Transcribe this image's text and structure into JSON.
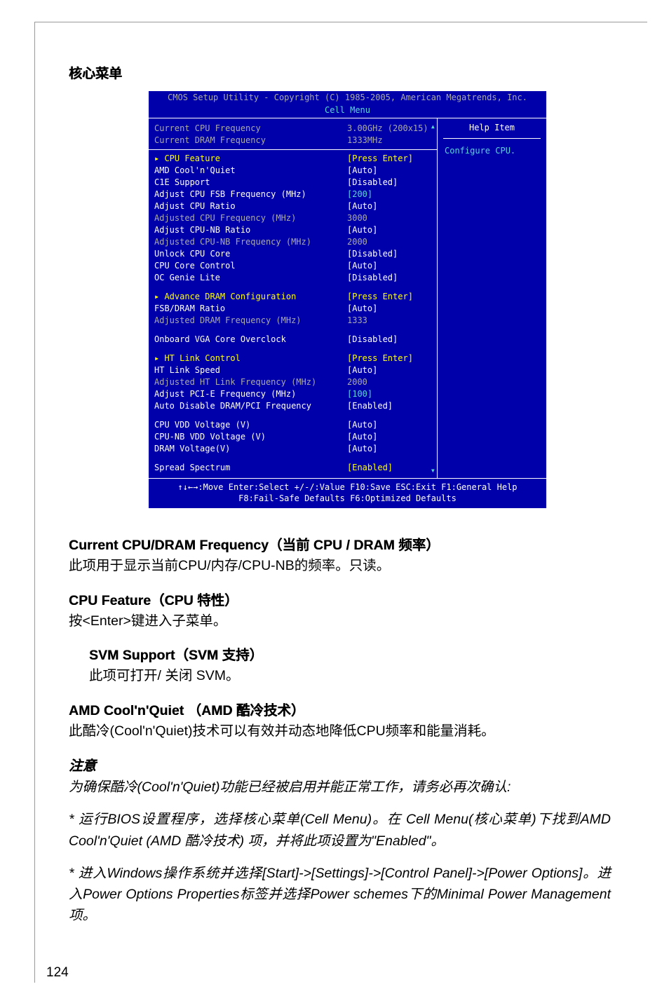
{
  "page": {
    "number": "124",
    "section_heading": "核心菜单"
  },
  "bios": {
    "titlebar": "CMOS Setup Utility - Copyright (C) 1985-2005, American Megatrends, Inc.",
    "subtitle": "Cell Menu",
    "help_title": "Help Item",
    "help_body": "Configure CPU.",
    "rows": [
      {
        "label": "Current CPU Frequency",
        "value": "3.00GHz (200x15)",
        "lcls": "bios-gray",
        "vcls": "bios-gray"
      },
      {
        "label": "Current DRAM Frequency",
        "value": "1333MHz",
        "lcls": "bios-gray",
        "vcls": "bios-gray"
      },
      {
        "type": "hr"
      },
      {
        "label": "▸ CPU Feature",
        "value": "[Press Enter]",
        "lcls": "bios-yellow",
        "vcls": "bios-yellow"
      },
      {
        "label": "AMD Cool'n'Quiet",
        "value": "[Auto]",
        "lcls": "bios-white",
        "vcls": "bios-white"
      },
      {
        "label": "C1E Support",
        "value": "[Disabled]",
        "lcls": "bios-white",
        "vcls": "bios-white"
      },
      {
        "label": "Adjust CPU FSB Frequency (MHz)",
        "value": "[200]",
        "lcls": "bios-white",
        "vcls": "bios-cyan"
      },
      {
        "label": "Adjust CPU Ratio",
        "value": "[Auto]",
        "lcls": "bios-white",
        "vcls": "bios-white"
      },
      {
        "label": "Adjusted CPU Frequency (MHz)",
        "value": "3000",
        "lcls": "bios-gray",
        "vcls": "bios-gray"
      },
      {
        "label": "Adjust CPU-NB Ratio",
        "value": "[Auto]",
        "lcls": "bios-white",
        "vcls": "bios-white"
      },
      {
        "label": "Adjusted CPU-NB Frequency (MHz)",
        "value": "2000",
        "lcls": "bios-gray",
        "vcls": "bios-gray"
      },
      {
        "label": "Unlock CPU Core",
        "value": "[Disabled]",
        "lcls": "bios-white",
        "vcls": "bios-white"
      },
      {
        "label": "CPU Core Control",
        "value": "[Auto]",
        "lcls": "bios-white",
        "vcls": "bios-white"
      },
      {
        "label": "OC Genie Lite",
        "value": "[Disabled]",
        "lcls": "bios-white",
        "vcls": "bios-white"
      },
      {
        "type": "sep"
      },
      {
        "label": "▸ Advance DRAM Configuration",
        "value": "[Press Enter]",
        "lcls": "bios-yellow",
        "vcls": "bios-yellow"
      },
      {
        "label": "FSB/DRAM Ratio",
        "value": "[Auto]",
        "lcls": "bios-white",
        "vcls": "bios-white"
      },
      {
        "label": "Adjusted DRAM Frequency (MHz)",
        "value": "1333",
        "lcls": "bios-gray",
        "vcls": "bios-gray"
      },
      {
        "type": "sep"
      },
      {
        "label": "Onboard VGA Core Overclock",
        "value": "[Disabled]",
        "lcls": "bios-white",
        "vcls": "bios-white"
      },
      {
        "type": "sep"
      },
      {
        "label": "▸ HT Link Control",
        "value": "[Press Enter]",
        "lcls": "bios-yellow",
        "vcls": "bios-yellow"
      },
      {
        "label": "HT Link Speed",
        "value": "[Auto]",
        "lcls": "bios-white",
        "vcls": "bios-white"
      },
      {
        "label": "Adjusted HT Link Frequency (MHz)",
        "value": "2000",
        "lcls": "bios-gray",
        "vcls": "bios-gray"
      },
      {
        "label": "Adjust PCI-E Frequency (MHz)",
        "value": "[100]",
        "lcls": "bios-white",
        "vcls": "bios-cyan"
      },
      {
        "label": "Auto Disable DRAM/PCI Frequency",
        "value": "[Enabled]",
        "lcls": "bios-white",
        "vcls": "bios-white"
      },
      {
        "type": "sep"
      },
      {
        "label": "CPU VDD Voltage (V)",
        "value": "[Auto]",
        "lcls": "bios-white",
        "vcls": "bios-white"
      },
      {
        "label": "CPU-NB VDD Voltage (V)",
        "value": "[Auto]",
        "lcls": "bios-white",
        "vcls": "bios-white"
      },
      {
        "label": "DRAM Voltage(V)",
        "value": "[Auto]",
        "lcls": "bios-white",
        "vcls": "bios-white"
      },
      {
        "type": "sep"
      },
      {
        "label": "Spread Spectrum",
        "value": "[Enabled]",
        "lcls": "bios-white",
        "vcls": "bios-yellow"
      }
    ],
    "footer_line1": "↑↓←→:Move  Enter:Select  +/-/:Value  F10:Save  ESC:Exit  F1:General Help",
    "footer_line2": "F8:Fail-Safe Defaults   F6:Optimized Defaults"
  },
  "descriptions": [
    {
      "title": "Current CPU/DRAM Frequency（当前 CPU / DRAM 频率）",
      "body": "此项用于显示当前CPU/内存/CPU-NB的频率。只读。",
      "indent": false
    },
    {
      "title": "CPU Feature（CPU 特性）",
      "body": "按<Enter>键进入子菜单。",
      "indent": false
    },
    {
      "title": "SVM Support（SVM 支持）",
      "body": "此项可打开/ 关闭 SVM。",
      "indent": true
    },
    {
      "title": "AMD Cool'n'Quiet （AMD 酷冷技术）",
      "body": "此酷冷(Cool'n'Quiet)技术可以有效并动态地降低CPU频率和能量消耗。",
      "indent": false
    }
  ],
  "note": {
    "title": "注意",
    "lead": "为确保酷冷(Cool'n'Quiet)功能已经被启用并能正常工作，请务必再次确认:",
    "items": [
      "*  运行BIOS设置程序，选择核心菜单(Cell Menu)。在 Cell Menu(核心菜单)下找到AMD Cool'n'Quiet (AMD 酷冷技术) 项，并将此项设置为\"Enabled\"。",
      "*  进入Windows操作系统并选择[Start]->[Settings]->[Control Panel]->[Power Options]。进入Power Options Properties标签并选择Power schemes下的Minimal Power Management项。"
    ]
  }
}
